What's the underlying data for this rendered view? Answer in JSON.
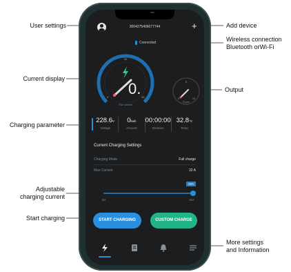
{
  "callouts": {
    "user_settings": "User settings",
    "add_device": "Add device",
    "wireless_1": "Wireless connection",
    "wireless_2": "Bluetooth orWi-Fi",
    "current_display": "Current display",
    "output": "Output",
    "charging_parameter": "Charging parameter",
    "adjustable_1": "Adjustable",
    "adjustable_2": "charging current",
    "start_charging": "Start charging",
    "more_1": "More settings",
    "more_2": "and Information"
  },
  "header": {
    "device_id": "3004275406077744",
    "connection_status": "Connected"
  },
  "gauge": {
    "value": "0.",
    "label": "The current",
    "min_tick": "0",
    "mid_tick": "20",
    "max_tick": "40"
  },
  "power_gauge": {
    "label": "Power",
    "top_tick": "5",
    "min_tick": "0",
    "max_tick": "10"
  },
  "params": [
    {
      "value": "228.6",
      "unit": "V",
      "label": "Voltage"
    },
    {
      "value": "0",
      "unit": "kwh",
      "label": "Amount"
    },
    {
      "value": "00:00:00",
      "unit": "",
      "label": "Duration"
    },
    {
      "value": "32.8",
      "unit": "°C",
      "label": "Temp"
    }
  ],
  "settings": {
    "title": "Current Charging Settings",
    "mode_label": "Charging Mode",
    "mode_value": "Full charge",
    "max_label": "Max Current",
    "max_value": "32 A"
  },
  "slider": {
    "tooltip": "32A",
    "min_label": "6A",
    "max_label": "32A",
    "level_fraction": 1.0
  },
  "buttons": {
    "start": "START CHARGING",
    "custom": "CUSTOM CHARGE"
  },
  "colors": {
    "accent_blue": "#2a90d8",
    "accent_green": "#23b38a",
    "bolt_green": "#2fcf8a",
    "screen_bg": "#1c1d1f"
  },
  "tabs": [
    "bolt-icon",
    "document-icon",
    "bell-icon",
    "menu-icon"
  ]
}
